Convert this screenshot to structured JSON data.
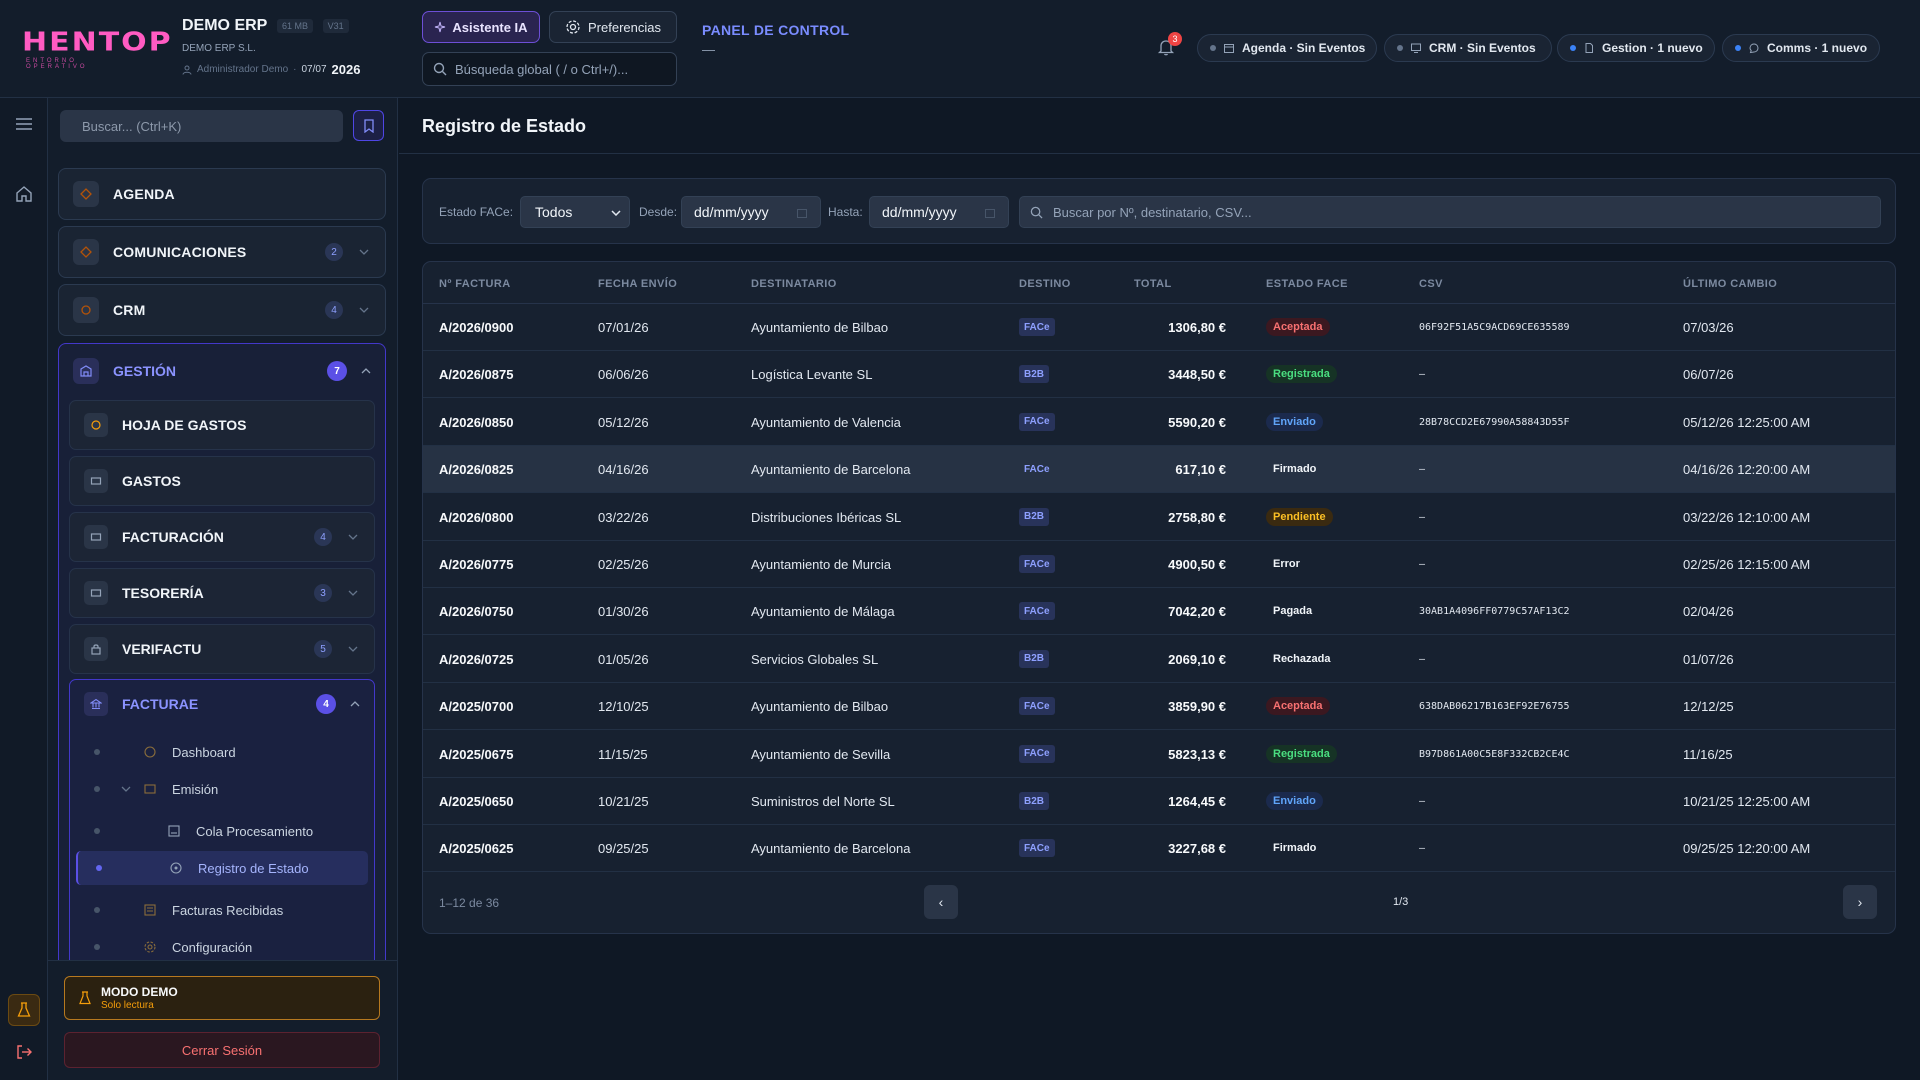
{
  "app": {
    "logo": "HENTOP",
    "logo_sub": "ENTORNO OPERATIVO",
    "company_name": "DEMO ERP",
    "size_badge": "61 MB",
    "version_badge": "V31",
    "legal_name": "DEMO ERP S.L.",
    "user": "Administrador Demo",
    "date": "07/07",
    "year": "2026"
  },
  "header": {
    "ai_button": "Asistente IA",
    "prefs_button": "Preferencias",
    "search_placeholder": "Búsqueda global ( / o Ctrl+/)...",
    "panel_title": "PANEL DE CONTROL",
    "panel_sub": "—",
    "notif_count": "3",
    "status_pills": [
      {
        "label": "Agenda · Sin Eventos",
        "dot_color": "#64748b"
      },
      {
        "label": "CRM · Sin Eventos",
        "dot_color": "#64748b"
      },
      {
        "label": "Gestion · 1 nuevo",
        "dot_color": "#3b82f6"
      },
      {
        "label": "Comms · 1 nuevo",
        "dot_color": "#3b82f6"
      }
    ]
  },
  "sidebar": {
    "search_placeholder": "Buscar... (Ctrl+K)",
    "menu": [
      {
        "label": "AGENDA",
        "count": ""
      },
      {
        "label": "COMUNICACIONES",
        "count": "2"
      },
      {
        "label": "CRM",
        "count": "4"
      }
    ],
    "gestion": {
      "label": "GESTIÓN",
      "count": "7",
      "items": [
        {
          "label": "HOJA DE GASTOS",
          "count": ""
        },
        {
          "label": "GASTOS",
          "count": ""
        },
        {
          "label": "FACTURACIÓN",
          "count": "4"
        },
        {
          "label": "TESORERÍA",
          "count": "3"
        },
        {
          "label": "VERIFACTU",
          "count": "5"
        }
      ],
      "facturae": {
        "label": "FACTURAE",
        "count": "4",
        "tree": [
          {
            "label": "Dashboard"
          },
          {
            "label": "Emisión"
          },
          {
            "label": "Cola Procesamiento"
          },
          {
            "label": "Registro de Estado"
          },
          {
            "label": "Facturas Recibidas"
          },
          {
            "label": "Configuración"
          }
        ]
      }
    },
    "demo_title": "MODO DEMO",
    "demo_sub": "Solo lectura",
    "logout": "Cerrar Sesión"
  },
  "main": {
    "title": "Registro de Estado",
    "filters": {
      "estado_label": "Estado FACe:",
      "estado_value": "Todos",
      "desde_label": "Desde:",
      "desde_placeholder": "dd/mm/yyyy",
      "hasta_label": "Hasta:",
      "hasta_placeholder": "dd/mm/yyyy",
      "search_placeholder": "Buscar por Nº, destinatario, CSV..."
    },
    "columns": [
      "Nº FACTURA",
      "FECHA ENVÍO",
      "DESTINATARIO",
      "DESTINO",
      "TOTAL",
      "ESTADO FACE",
      "CSV",
      "ÚLTIMO CAMBIO"
    ],
    "rows": [
      {
        "num": "A/2026/0900",
        "fecha": "07/01/26",
        "dest": "Ayuntamiento de Bilbao",
        "destino": "FACe",
        "total": "1306,80 €",
        "estado": "Aceptada",
        "csv": "06F92F51A5C9ACD69CE635589",
        "cambio": "07/03/26"
      },
      {
        "num": "A/2026/0875",
        "fecha": "06/06/26",
        "dest": "Logística Levante SL",
        "destino": "B2B",
        "total": "3448,50 €",
        "estado": "Registrada",
        "csv": "–",
        "cambio": "06/07/26"
      },
      {
        "num": "A/2026/0850",
        "fecha": "05/12/26",
        "dest": "Ayuntamiento de Valencia",
        "destino": "FACe",
        "total": "5590,20 €",
        "estado": "Enviado",
        "csv": "28B78CCD2E67990A58843D55F",
        "cambio": "05/12/26 12:25:00 AM"
      },
      {
        "num": "A/2026/0825",
        "fecha": "04/16/26",
        "dest": "Ayuntamiento de Barcelona",
        "destino": "FACe",
        "total": "617,10 €",
        "estado": "Firmado",
        "csv": "–",
        "cambio": "04/16/26 12:20:00 AM"
      },
      {
        "num": "A/2026/0800",
        "fecha": "03/22/26",
        "dest": "Distribuciones Ibéricas SL",
        "destino": "B2B",
        "total": "2758,80 €",
        "estado": "Pendiente",
        "csv": "–",
        "cambio": "03/22/26 12:10:00 AM"
      },
      {
        "num": "A/2026/0775",
        "fecha": "02/25/26",
        "dest": "Ayuntamiento de Murcia",
        "destino": "FACe",
        "total": "4900,50 €",
        "estado": "Error",
        "csv": "–",
        "cambio": "02/25/26 12:15:00 AM"
      },
      {
        "num": "A/2026/0750",
        "fecha": "01/30/26",
        "dest": "Ayuntamiento de Málaga",
        "destino": "FACe",
        "total": "7042,20 €",
        "estado": "Pagada",
        "csv": "30AB1A4096FF0779C57AF13C2",
        "cambio": "02/04/26"
      },
      {
        "num": "A/2026/0725",
        "fecha": "01/05/26",
        "dest": "Servicios Globales SL",
        "destino": "B2B",
        "total": "2069,10 €",
        "estado": "Rechazada",
        "csv": "–",
        "cambio": "01/07/26"
      },
      {
        "num": "A/2025/0700",
        "fecha": "12/10/25",
        "dest": "Ayuntamiento de Bilbao",
        "destino": "FACe",
        "total": "3859,90 €",
        "estado": "Aceptada",
        "csv": "638DAB06217B163EF92E76755",
        "cambio": "12/12/25"
      },
      {
        "num": "A/2025/0675",
        "fecha": "11/15/25",
        "dest": "Ayuntamiento de Sevilla",
        "destino": "FACe",
        "total": "5823,13 €",
        "estado": "Registrada",
        "csv": "B97D861A00C5E8F332CB2CE4C",
        "cambio": "11/16/25"
      },
      {
        "num": "A/2025/0650",
        "fecha": "10/21/25",
        "dest": "Suministros del Norte SL",
        "destino": "B2B",
        "total": "1264,45 €",
        "estado": "Enviado",
        "csv": "–",
        "cambio": "10/21/25 12:25:00 AM"
      },
      {
        "num": "A/2025/0625",
        "fecha": "09/25/25",
        "dest": "Ayuntamiento de Barcelona",
        "destino": "FACe",
        "total": "3227,68 €",
        "estado": "Firmado",
        "csv": "–",
        "cambio": "09/25/25 12:20:00 AM"
      }
    ],
    "status_styles": {
      "Aceptada": {
        "bg": "#3b1820",
        "fg": "#f87171"
      },
      "Registrada": {
        "bg": "#163325",
        "fg": "#4ade80"
      },
      "Enviado": {
        "bg": "#1b2a4d",
        "fg": "#60a5fa"
      },
      "Pendiente": {
        "bg": "#3a2a10",
        "fg": "#fbbf24"
      },
      "Firmado": {
        "bg": "transparent",
        "fg": "#f1f5f9"
      },
      "Error": {
        "bg": "transparent",
        "fg": "#f1f5f9"
      },
      "Pagada": {
        "bg": "transparent",
        "fg": "#f1f5f9"
      },
      "Rechazada": {
        "bg": "transparent",
        "fg": "#f1f5f9"
      }
    },
    "highlighted_row": 3,
    "footer": {
      "range": "1–12 de 36",
      "page": "1/3",
      "prev": "‹",
      "next": "›"
    }
  }
}
